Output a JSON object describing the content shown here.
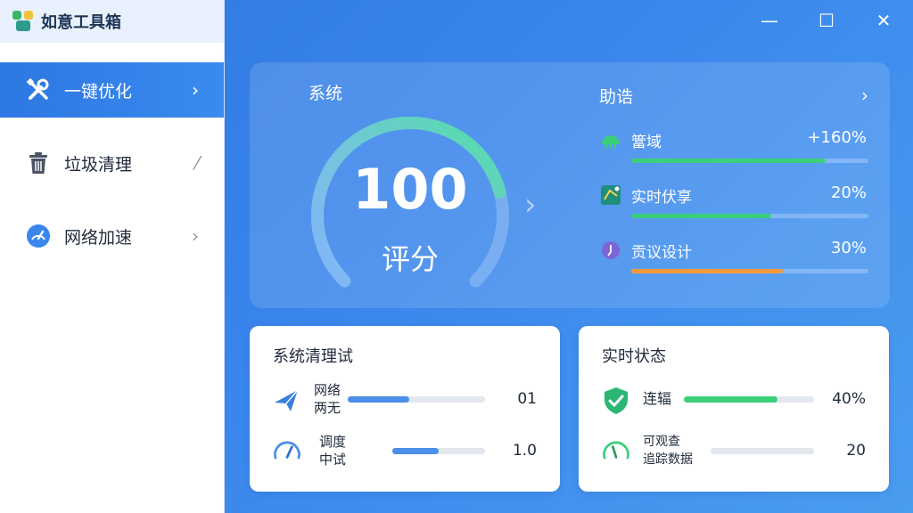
{
  "app": {
    "title": "如意工具箱"
  },
  "window_controls": {
    "minimize": "—",
    "maximize": "☐",
    "close": "✕"
  },
  "sidebar": {
    "items": [
      {
        "label": "一键优化",
        "arrow": "›",
        "icon": "tools-icon",
        "active": true
      },
      {
        "label": "垃圾清理",
        "arrow": "⁄",
        "icon": "trash-icon",
        "active": false
      },
      {
        "label": "网络加速",
        "arrow": "›",
        "icon": "speedometer-icon",
        "active": false
      }
    ]
  },
  "hero": {
    "title": "系统",
    "score": "100",
    "score_label": "评分",
    "gauge_fraction": 0.78,
    "chevron": "›"
  },
  "assist": {
    "title": "助诰",
    "more": "›",
    "metrics": [
      {
        "label": "簹域",
        "value": "+160%",
        "fraction": 0.82,
        "color": "#3ccf7a",
        "icon": "cloud-icon"
      },
      {
        "label": "实时伏享",
        "value": "20%",
        "fraction": 0.59,
        "color": "#3ccf7a",
        "icon": "share-icon"
      },
      {
        "label": "贡议设计",
        "value": "30%",
        "fraction": 0.64,
        "color": "#f59a3c",
        "icon": "design-icon"
      }
    ]
  },
  "card_clean": {
    "title": "系统清理试",
    "rows": [
      {
        "label": "网络\n两无",
        "value": "01",
        "fraction": 0.45,
        "color": "#4a8fe8",
        "icon": "rocket-icon"
      },
      {
        "label": "调度\n中试",
        "value": "1.0",
        "fraction": 0.5,
        "color": "#4a8fe8",
        "icon": "gauge-icon"
      }
    ]
  },
  "card_status": {
    "title": "实时状态",
    "rows": [
      {
        "label": "连辐",
        "value": "40%",
        "fraction": 0.72,
        "color": "#3ccf7a",
        "icon": "shield-check-icon"
      },
      {
        "label": "可观查\n追踪数据",
        "value": "20",
        "fraction": 0.0,
        "color": "#3ccf7a",
        "icon": "meter-icon"
      }
    ]
  }
}
